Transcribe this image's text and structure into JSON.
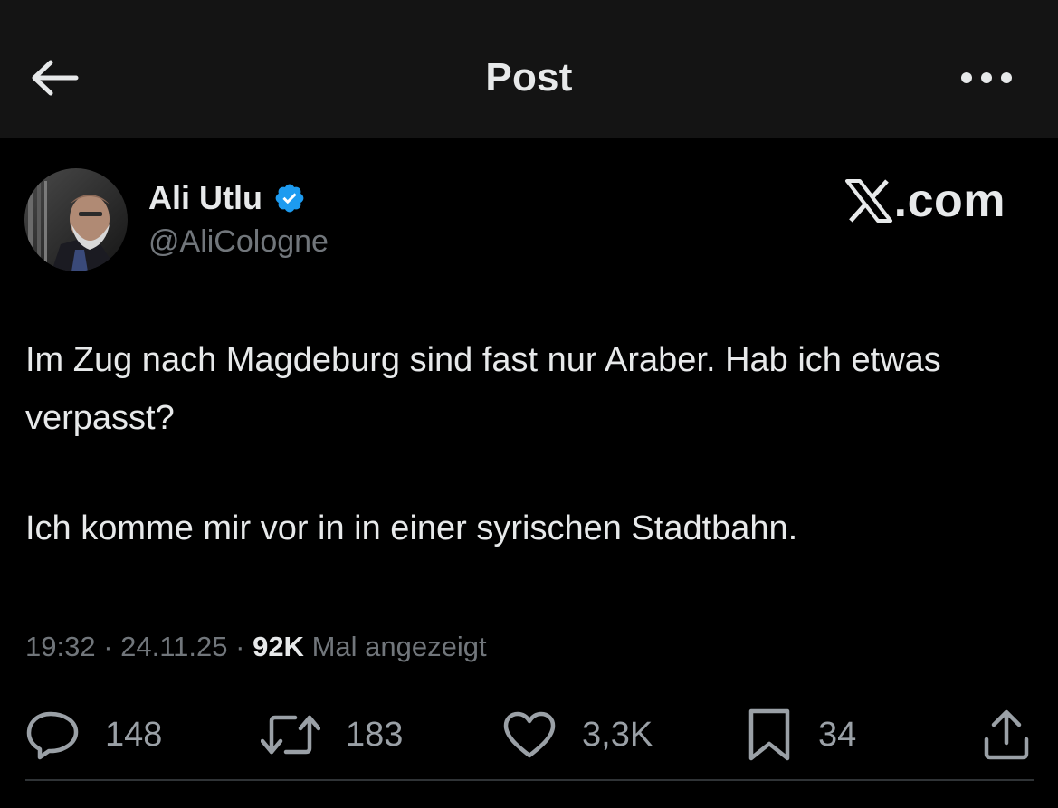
{
  "header": {
    "title": "Post",
    "back_icon": "arrow-left-icon",
    "more_icon": "more-horizontal-icon"
  },
  "author": {
    "name": "Ali Utlu",
    "handle": "@AliCologne",
    "verified": true,
    "verified_color": "#1d9bf0"
  },
  "watermark": {
    "text": ".com",
    "logo": "x-logo-icon"
  },
  "tweet": {
    "paragraphs": [
      "Im Zug nach Magdeburg sind fast nur Araber. Hab ich etwas verpasst?",
      "Ich komme mir vor in in einer syrischen Stadtbahn."
    ]
  },
  "meta": {
    "time": "19:32",
    "separator": " · ",
    "date": "24.11.25",
    "views": "92K",
    "views_label": "Mal angezeigt"
  },
  "actions": {
    "replies": "148",
    "reposts": "183",
    "likes": "3,3K",
    "bookmarks": "34"
  },
  "colors": {
    "background": "#000000",
    "topbar": "#141414",
    "text_primary": "#e7e9ea",
    "text_secondary": "#71767b",
    "divider": "#2f3336"
  }
}
